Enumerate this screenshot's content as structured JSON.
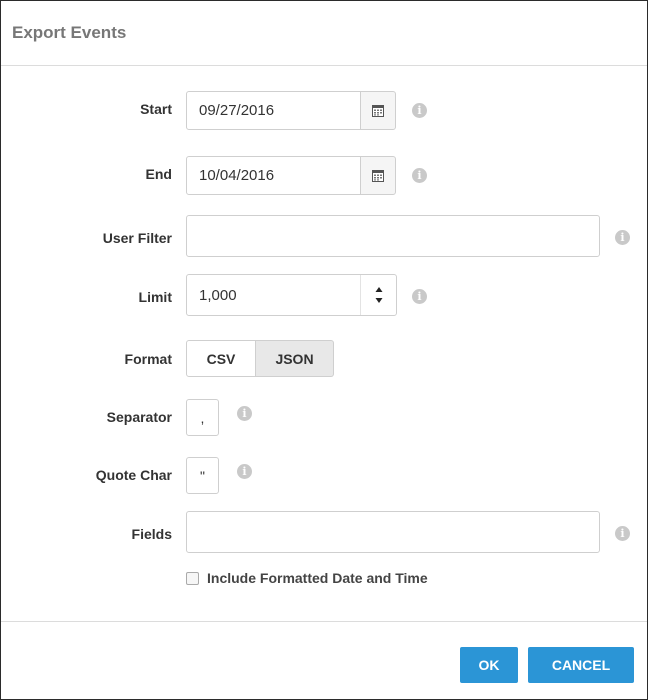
{
  "dialog": {
    "title": "Export Events"
  },
  "fields": {
    "start": {
      "label": "Start",
      "value": "09/27/2016"
    },
    "end": {
      "label": "End",
      "value": "10/04/2016"
    },
    "user_filter": {
      "label": "User Filter",
      "value": ""
    },
    "limit": {
      "label": "Limit",
      "value": "1,000"
    },
    "format": {
      "label": "Format",
      "options": [
        "CSV",
        "JSON"
      ],
      "selected": "JSON"
    },
    "separator": {
      "label": "Separator",
      "value": ","
    },
    "quote_char": {
      "label": "Quote Char",
      "value": "\""
    },
    "fields": {
      "label": "Fields",
      "value": ""
    }
  },
  "options": {
    "include_formatted_label": "Include Formatted Date and Time",
    "include_formatted_checked": false
  },
  "footer": {
    "ok_label": "OK",
    "cancel_label": "CANCEL"
  },
  "icons": {
    "info": "info-icon",
    "calendar": "calendar-icon",
    "spinner": "spinner-arrows-icon"
  },
  "colors": {
    "primary_button": "#2b95d6",
    "info_icon": "#c9c9c9",
    "title_text": "#777777"
  }
}
